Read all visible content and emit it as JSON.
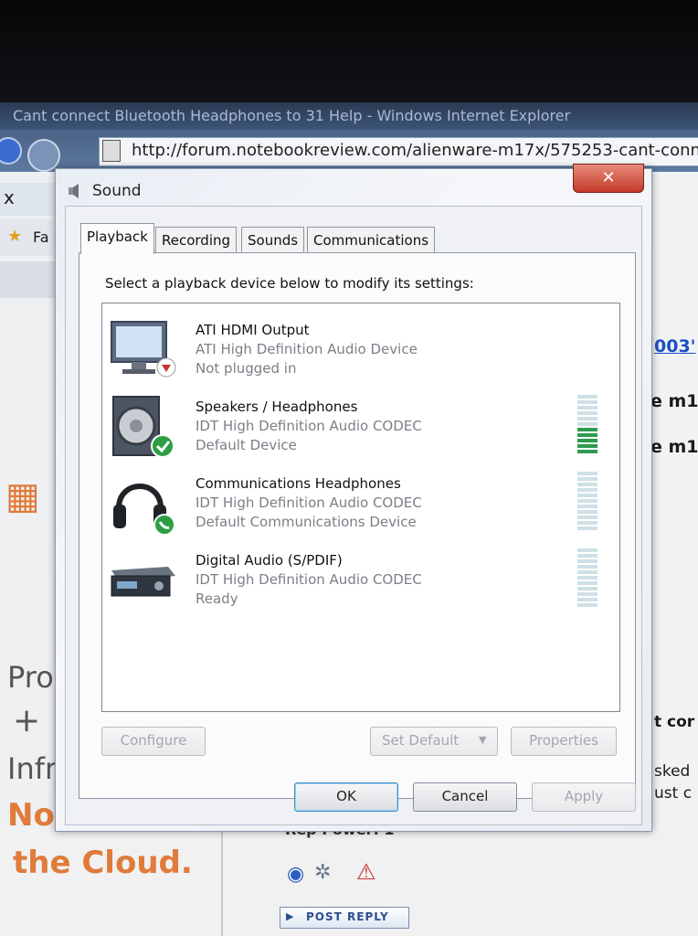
{
  "browser": {
    "window_title": "Cant connect Bluetooth Headphones to 31 Help - Windows Internet Explorer",
    "url": "http://forum.notebookreview.com/alienware-m17x/575253-cant-connect-",
    "left_fragments": [
      "x",
      "Fa"
    ],
    "right_fragments": [
      "003'",
      "e m1",
      "e m1",
      "t cor",
      "sked",
      "ust c"
    ],
    "ad_text": {
      "line1": "Pro",
      "line2": "+",
      "line3": "Infr",
      "line4": "No",
      "line5": "the Cloud."
    },
    "post_reply": "POST REPLY",
    "rep_power": "Rep Power: 1"
  },
  "dialog": {
    "title": "Sound",
    "close_label": "✕",
    "tabs": [
      {
        "label": "Playback"
      },
      {
        "label": "Recording"
      },
      {
        "label": "Sounds"
      },
      {
        "label": "Communications"
      }
    ],
    "instruction": "Select a playback device below to modify its settings:",
    "devices": [
      {
        "name": "ATI HDMI Output",
        "description": "ATI High Definition Audio Device",
        "status": "Not plugged in",
        "icon": "monitor-icon",
        "badge": "down-arrow-badge",
        "meter_level": 0
      },
      {
        "name": "Speakers / Headphones",
        "description": "IDT High Definition Audio CODEC",
        "status": "Default Device",
        "icon": "speaker-icon",
        "badge": "green-check-badge",
        "meter_level": 0.45
      },
      {
        "name": "Communications Headphones",
        "description": "IDT High Definition Audio CODEC",
        "status": "Default Communications Device",
        "icon": "headphones-icon",
        "badge": "green-phone-badge",
        "meter_level": 0
      },
      {
        "name": "Digital Audio (S/PDIF)",
        "description": "IDT High Definition Audio CODEC",
        "status": "Ready",
        "icon": "receiver-icon",
        "badge": "",
        "meter_level": 0
      }
    ],
    "buttons": {
      "configure": "Configure",
      "set_default": "Set Default",
      "properties": "Properties",
      "ok": "OK",
      "cancel": "Cancel",
      "apply": "Apply"
    },
    "colors": {
      "meter_active": "#2f9b4f",
      "meter_inactive": "#cfe0e6",
      "close_red": "#c33a28"
    }
  }
}
